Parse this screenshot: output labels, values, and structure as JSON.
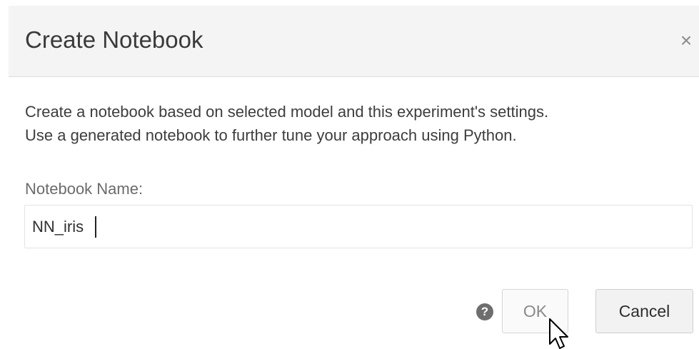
{
  "dialog": {
    "title": "Create Notebook",
    "close_symbol": "×",
    "description_line1": "Create a notebook based on selected model and this experiment's settings.",
    "description_line2": "Use a generated notebook to further tune your approach using Python.",
    "field_label": "Notebook Name:",
    "notebook_name_value": "NN_iris",
    "help_symbol": "?",
    "ok_label": "OK",
    "cancel_label": "Cancel"
  },
  "icons": {
    "close": "close-icon",
    "help": "help-icon",
    "cursor": "mouse-pointer-icon"
  },
  "colors": {
    "header_bg": "#f4f4f4",
    "help_icon_bg": "#6e6e6e"
  }
}
